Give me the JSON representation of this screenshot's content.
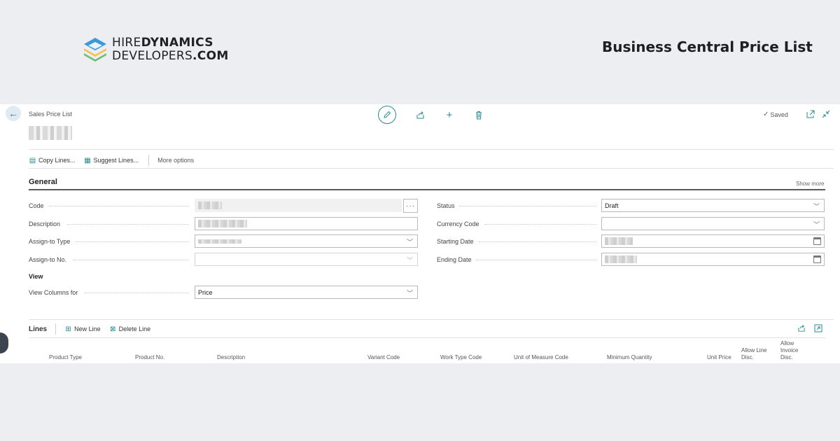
{
  "banner": {
    "logo_line1_light": "HIRE",
    "logo_line1_bold": "DYNAMICS",
    "logo_line2_light": "DEVELOPERS",
    "logo_line2_bold": ".COM",
    "title": "Business Central Price List"
  },
  "page": {
    "breadcrumb": "Sales Price List",
    "saved_label": "Saved"
  },
  "actions": {
    "copy_lines": "Copy Lines...",
    "suggest_lines": "Suggest Lines...",
    "more_options": "More options"
  },
  "general": {
    "title": "General",
    "show_more": "Show more",
    "fields": {
      "code_label": "Code",
      "description_label": "Description",
      "assign_to_type_label": "Assign-to Type",
      "assign_to_no_label": "Assign-to No.",
      "status_label": "Status",
      "status_value": "Draft",
      "currency_code_label": "Currency Code",
      "starting_date_label": "Starting Date",
      "ending_date_label": "Ending Date"
    },
    "view_heading": "View",
    "view_columns_label": "View Columns for",
    "view_columns_value": "Price"
  },
  "lines": {
    "title": "Lines",
    "new_line": "New Line",
    "delete_line": "Delete Line",
    "columns": [
      "Product Type",
      "Product No.",
      "Description",
      "Variant Code",
      "Work Type Code",
      "Unit of Measure Code",
      "Minimum Quantity",
      "Unit Price",
      "Allow Line Disc.",
      "Allow Invoice Disc."
    ]
  },
  "colors": {
    "accent": "#2a8a8f",
    "background": "#edeef2",
    "panel": "#ffffff"
  }
}
